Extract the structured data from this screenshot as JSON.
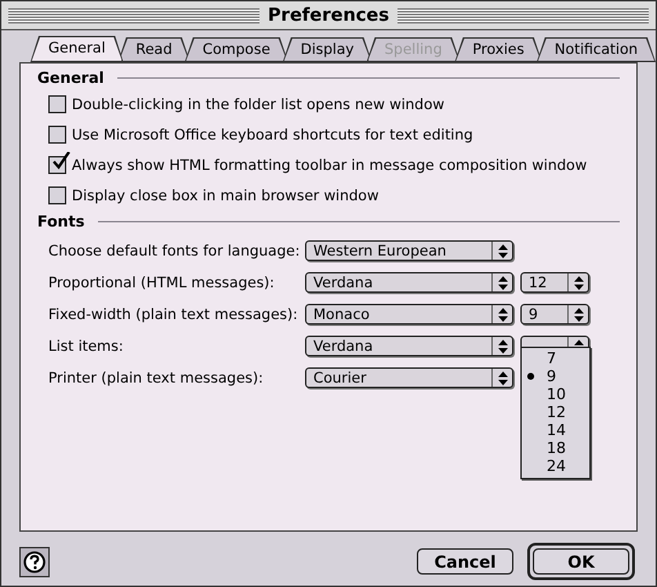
{
  "window": {
    "title": "Preferences"
  },
  "tabs": [
    {
      "label": "General",
      "selected": true,
      "disabled": false
    },
    {
      "label": "Read",
      "selected": false,
      "disabled": false
    },
    {
      "label": "Compose",
      "selected": false,
      "disabled": false
    },
    {
      "label": "Display",
      "selected": false,
      "disabled": false
    },
    {
      "label": "Spelling",
      "selected": false,
      "disabled": true
    },
    {
      "label": "Proxies",
      "selected": false,
      "disabled": false
    },
    {
      "label": "Notification",
      "selected": false,
      "disabled": false
    }
  ],
  "general": {
    "title": "General",
    "options": [
      {
        "label": "Double-clicking in the folder list opens new window",
        "checked": false
      },
      {
        "label": "Use Microsoft Office keyboard shortcuts for text editing",
        "checked": false
      },
      {
        "label": "Always show HTML formatting toolbar in message composition window",
        "checked": true
      },
      {
        "label": "Display close box in main browser window",
        "checked": false
      }
    ]
  },
  "fonts": {
    "title": "Fonts",
    "rows": [
      {
        "label": "Choose default fonts for language:",
        "font": "Western European"
      },
      {
        "label": "Proportional (HTML messages):",
        "font": "Verdana",
        "size": "12"
      },
      {
        "label": "Fixed-width (plain text messages):",
        "font": "Monaco",
        "size": "9"
      },
      {
        "label": "List items:",
        "font": "Verdana",
        "menu": [
          {
            "label": "7",
            "selected": false
          },
          {
            "label": "9",
            "selected": true
          },
          {
            "label": "10",
            "selected": false
          },
          {
            "label": "12",
            "selected": false
          },
          {
            "label": "14",
            "selected": false
          },
          {
            "label": "18",
            "selected": false
          },
          {
            "label": "24",
            "selected": false
          }
        ]
      },
      {
        "label": "Printer (plain text messages):",
        "font": "Courier"
      }
    ]
  },
  "buttons": [
    {
      "label": "Cancel",
      "default": false
    },
    {
      "label": "OK",
      "default": true
    }
  ]
}
